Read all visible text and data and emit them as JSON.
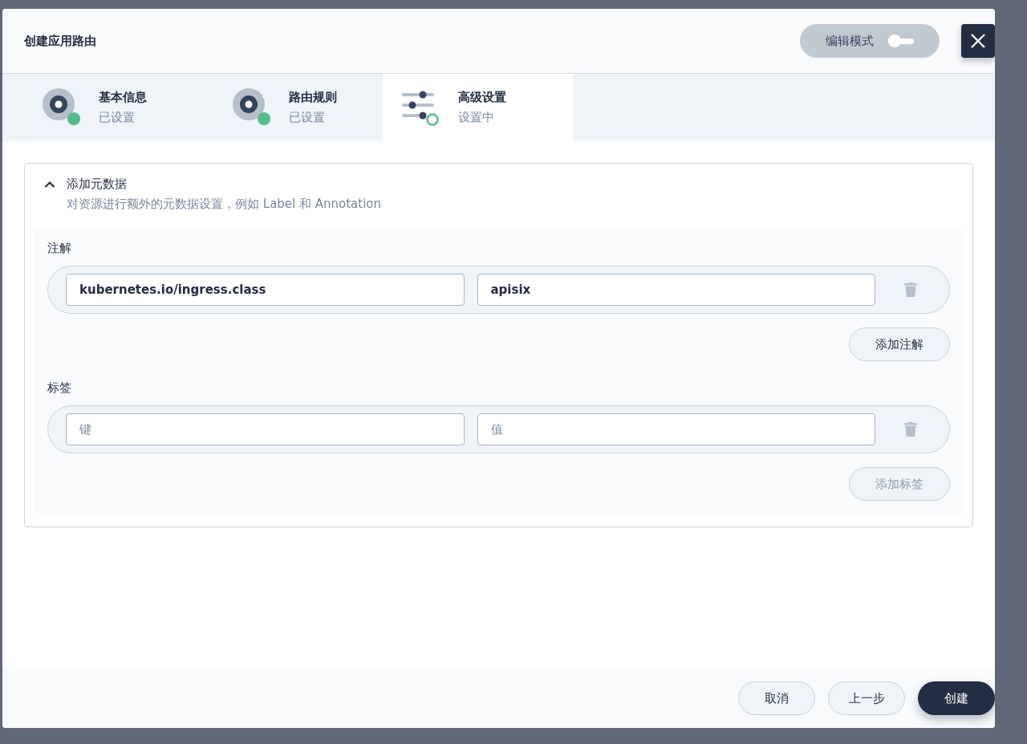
{
  "dialog": {
    "title": "创建应用路由",
    "edit_mode": {
      "label": "编辑模式",
      "on": false
    }
  },
  "steps": [
    {
      "title": "基本信息",
      "status": "已设置",
      "kind": "done",
      "selected": false
    },
    {
      "title": "路由规则",
      "status": "已设置",
      "kind": "done",
      "selected": false
    },
    {
      "title": "高级设置",
      "status": "设置中",
      "kind": "current",
      "selected": true
    }
  ],
  "section": {
    "title": "添加元数据",
    "expanded": true,
    "description": "对资源进行额外的元数据设置，例如 Label 和 Annotation",
    "groups": [
      {
        "label": "注解",
        "rows": [
          {
            "key": {
              "value": "kubernetes.io/ingress.class"
            },
            "val": {
              "value": "apisix"
            }
          }
        ],
        "add_button": {
          "label": "添加注解",
          "disabled": false
        }
      },
      {
        "label": "标签",
        "rows": [
          {
            "key": {
              "placeholder": "键"
            },
            "val": {
              "placeholder": "值"
            }
          }
        ],
        "add_button": {
          "label": "添加标签",
          "disabled": true
        }
      }
    ]
  },
  "footer": {
    "buttons": [
      {
        "label": "取消",
        "kind": "secondary"
      },
      {
        "label": "上一步",
        "kind": "secondary"
      },
      {
        "label": "创建",
        "kind": "primary"
      }
    ]
  }
}
